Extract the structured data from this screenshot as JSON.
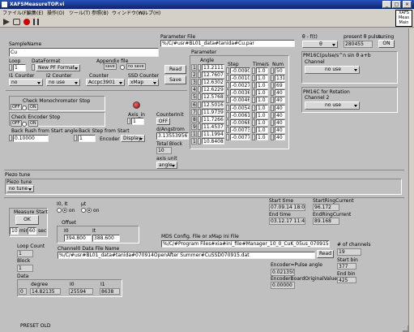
{
  "window": {
    "title": "XAFSMeasureTOP.vi"
  },
  "menu": [
    "ファイル(F)",
    "編集(E)",
    "操作(O)",
    "ツール(T)",
    "参照(B)",
    "ウィンドウ(W)",
    "ヘルプ(H)"
  ],
  "badge": {
    "line1": "XAFS",
    "line2": "Meas",
    "line3": "Main"
  },
  "sample": {
    "label": "SampleName",
    "value": "Cu"
  },
  "loop": {
    "label": "Loop",
    "value": "1"
  },
  "dataformat": {
    "label": "DataFormat",
    "value": "New PF Format"
  },
  "append": {
    "label": "Appendix file",
    "save": "save",
    "nosave": "no save"
  },
  "counters": [
    {
      "label": "I1 Counter",
      "value": "no"
    },
    {
      "label": "I2 Counter",
      "value": "no use"
    },
    {
      "label": "Counter",
      "value": "Accpc3901"
    },
    {
      "label": "SSD Counter",
      "value": "xMap"
    }
  ],
  "readsave": {
    "read": "Read",
    "save": "Save"
  },
  "paramfile": {
    "label": "Parameter File",
    "value": "%/C/#usr#BL01_data#tanida#Cu.par"
  },
  "parameter": {
    "label": "Parameter",
    "col_angle": "Angle",
    "col_step": "Step",
    "col_time": "Time/s",
    "col_num": "Num",
    "rows": [
      {
        "idx": "1",
        "angle": "13.21110",
        "step": "-0.00901",
        "time": "1.0",
        "num": "50"
      },
      {
        "idx": "2",
        "angle": "12.76079",
        "step": "-0.00100",
        "time": "1.0",
        "num": "131"
      },
      {
        "idx": "3",
        "angle": "12.63024",
        "step": "-0.00275",
        "time": "1.0",
        "num": "69"
      },
      {
        "idx": "4",
        "angle": "12.62294",
        "step": "-0.00368",
        "time": "1.0",
        "num": "40"
      },
      {
        "idx": "5",
        "angle": "12.57682",
        "step": "-0.00460",
        "time": "1.0",
        "num": "40"
      },
      {
        "idx": "6",
        "angle": "12.50169",
        "step": "-0.00544",
        "time": "1.0",
        "num": "40"
      },
      {
        "idx": "7",
        "angle": "11.97398",
        "step": "-0.00610",
        "time": "1.0",
        "num": "40"
      },
      {
        "idx": "8",
        "angle": "11.72667",
        "step": "-0.00682",
        "time": "1.0",
        "num": "40"
      },
      {
        "idx": "9",
        "angle": "11.45372",
        "step": "-0.00736",
        "time": "1.0",
        "num": "40"
      },
      {
        "idx": "10",
        "angle": "11.19944",
        "step": "-0.00776",
        "time": "1.0",
        "num": "40"
      },
      {
        "idx": "11",
        "angle": "10.84083",
        "step": "",
        "time": "",
        "num": ""
      }
    ]
  },
  "counterinit": {
    "label": "CounterInit",
    "value": "OFF"
  },
  "dangstrom": {
    "label": "d/Angstrom",
    "value": "3.1355395678"
  },
  "totalblock": {
    "label": "Total Block",
    "value": "10"
  },
  "axisunit": {
    "label": "axis unit",
    "value": "angle"
  },
  "axisin": {
    "label": "Axis_in",
    "value": "1"
  },
  "monostop": {
    "label": "Check Monochromator Stop",
    "off": "OFF",
    "on": "ON"
  },
  "encstop": {
    "label": "Check Encoder Stop",
    "off": "OFF",
    "on": "ON"
  },
  "backrush": {
    "label": "Back Rush from Start angle",
    "value": "0.10000"
  },
  "backstep": {
    "label": "Back Step from Start",
    "value": "1",
    "encoder": "Encoder",
    "display": "Display"
  },
  "theta": {
    "label": "θ - f(t)",
    "value": "θ"
  },
  "pulse": {
    "label": "present θ pulse",
    "value": "280455"
  },
  "tuning": {
    "label": "tuning",
    "value": "ON"
  },
  "pm16c": {
    "label": "PM16C(pulse/s^n sin θ a+b",
    "channel": "Channel",
    "value": "no use"
  },
  "pm16rot": {
    "label": "PM16C for Rotation",
    "channel": "Channel 2",
    "value": "no use"
  },
  "piezo": {
    "label": "Piezo tune",
    "inner": "Piezo tune",
    "value": "no tune"
  },
  "i0": {
    "label": "I0, It",
    "on": "on"
  },
  "mut": {
    "label": "μt",
    "on": "on"
  },
  "measure": {
    "label": "Measure Start",
    "ok": "OK"
  },
  "timer": {
    "min": "10",
    "min_u": "min",
    "sec": "60",
    "sec_u": "sec"
  },
  "offset": {
    "label": "Offset",
    "i0_label": "I0",
    "i0": "394.800",
    "it_label": "It",
    "it": "388.600"
  },
  "channelfile": {
    "label": "Channel0 Data File Name",
    "value": "%/C/#usr#BL01_data#tanida#070914OpenAfter Summer#CuSSD070915.dat"
  },
  "times": {
    "start_label": "Start time",
    "start": "07.09.14 18:04",
    "end_label": "End time",
    "end": "03.12.17 11:47"
  },
  "ring": {
    "start_label": "StartRingCurrent",
    "start": "96.172",
    "end_label": "EndRingCurrent",
    "end": "89.168"
  },
  "mds": {
    "label": "MDS Config. File or xMap ini File",
    "value": "%/C/#Program Files#xia#ini_file#Manager_10_0_CuK_05us_070915.ini",
    "read": "Read"
  },
  "nchannels": {
    "label": "# of channels",
    "value": "19"
  },
  "startbin": {
    "label": "Start bin",
    "value": "377"
  },
  "endbin": {
    "label": "End bin",
    "value": "425"
  },
  "loopcount": {
    "label": "Loop Count",
    "value": "1"
  },
  "block": {
    "label": "Block",
    "value": "1"
  },
  "data": {
    "label": "Data",
    "degree_label": "degree",
    "i0_label": "I0",
    "i1_label": "I1",
    "idx": "0",
    "degree": "14.82135",
    "i0": "25594",
    "i1": "8638"
  },
  "encoder_pa": {
    "label": "Encoder=Pulse angle",
    "value": "0.021350"
  },
  "encoder_orig": {
    "label": "EncoderBoardOriginalValue",
    "value": "0.00000"
  },
  "preset": "PRESET OLD"
}
